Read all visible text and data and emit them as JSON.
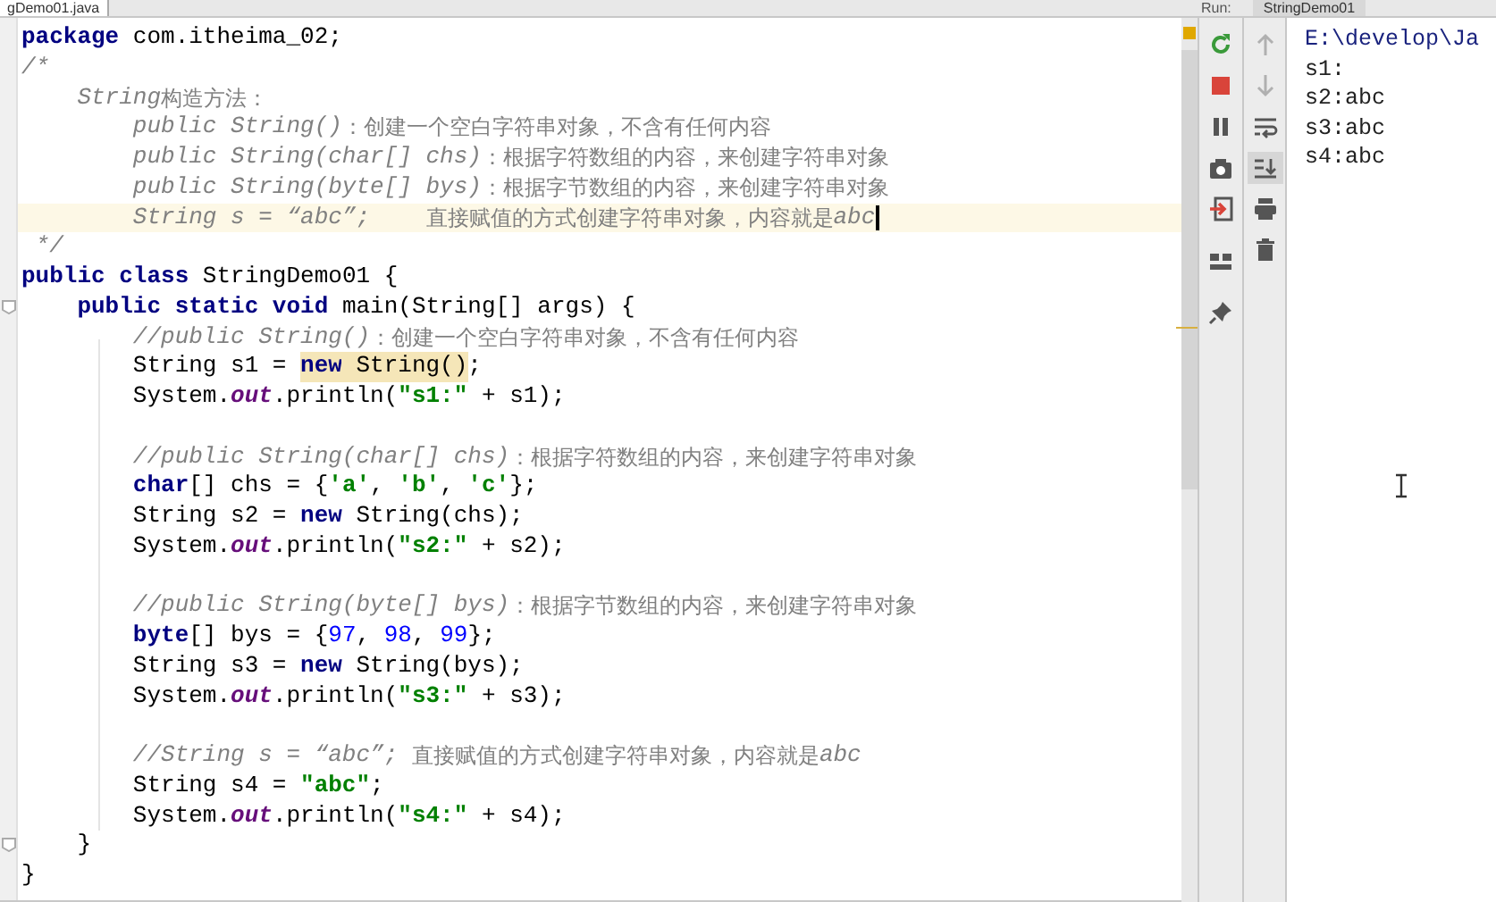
{
  "editor_tab": {
    "label": "gDemo01.java"
  },
  "run_panel": {
    "label": "Run:",
    "tab": "StringDemo01"
  },
  "code_lines": [
    {
      "current": false,
      "tokens": [
        {
          "kind": "keyword",
          "text": "package"
        },
        {
          "kind": "plain",
          "text": " com.itheima_02;"
        }
      ]
    },
    {
      "current": false,
      "tokens": [
        {
          "kind": "doc",
          "text": "/*"
        }
      ]
    },
    {
      "current": false,
      "tokens": [
        {
          "kind": "doc",
          "text": "    String"
        },
        {
          "kind": "cjk",
          "text": "构造方法："
        }
      ]
    },
    {
      "current": false,
      "tokens": [
        {
          "kind": "doc",
          "text": "        public String()"
        },
        {
          "kind": "cjk",
          "text": "：创建一个空白字符串对象，不含有任何内容"
        }
      ]
    },
    {
      "current": false,
      "tokens": [
        {
          "kind": "doc",
          "text": "        public String(char[] chs)"
        },
        {
          "kind": "cjk",
          "text": "：根据字符数组的内容，来创建字符串对象"
        }
      ]
    },
    {
      "current": false,
      "tokens": [
        {
          "kind": "doc",
          "text": "        public String(byte[] bys)"
        },
        {
          "kind": "cjk",
          "text": "：根据字节数组的内容，来创建字符串对象"
        }
      ]
    },
    {
      "current": true,
      "tokens": [
        {
          "kind": "doc",
          "text": "        String s = “abc”;    "
        },
        {
          "kind": "cjk",
          "text": "直接赋值的方式创建字符串对象，内容就是"
        },
        {
          "kind": "doc",
          "text": "abc"
        }
      ]
    },
    {
      "current": false,
      "tokens": [
        {
          "kind": "doc",
          "text": " */"
        }
      ]
    },
    {
      "current": false,
      "tokens": [
        {
          "kind": "keyword",
          "text": "public class"
        },
        {
          "kind": "plain",
          "text": " StringDemo01 {"
        }
      ]
    },
    {
      "current": false,
      "fold": true,
      "tokens": [
        {
          "kind": "keyword",
          "text": "    public static void"
        },
        {
          "kind": "plain",
          "text": " main(String[] args) {"
        }
      ]
    },
    {
      "current": false,
      "tokens": [
        {
          "kind": "doc",
          "text": "        //public String()"
        },
        {
          "kind": "cjk",
          "text": "：创建一个空白字符串对象，不含有任何内容"
        }
      ]
    },
    {
      "current": false,
      "tokens": [
        {
          "kind": "plain",
          "text": "        String s1 = "
        },
        {
          "kind": "match_keyword",
          "text": "new"
        },
        {
          "kind": "match_plain",
          "text": " String()"
        },
        {
          "kind": "plain",
          "text": ";"
        }
      ]
    },
    {
      "current": false,
      "tokens": [
        {
          "kind": "plain",
          "text": "        System."
        },
        {
          "kind": "field",
          "text": "out"
        },
        {
          "kind": "plain",
          "text": ".println("
        },
        {
          "kind": "string",
          "text": "\"s1:\""
        },
        {
          "kind": "plain",
          "text": " + s1);"
        }
      ]
    },
    {
      "current": false
    },
    {
      "current": false,
      "tokens": [
        {
          "kind": "doc",
          "text": "        //public String(char[] chs)"
        },
        {
          "kind": "cjk",
          "text": "：根据字符数组的内容，来创建字符串对象"
        }
      ]
    },
    {
      "current": false,
      "tokens": [
        {
          "kind": "keyword",
          "text": "        char"
        },
        {
          "kind": "plain",
          "text": "[] chs = {"
        },
        {
          "kind": "string",
          "text": "'a'"
        },
        {
          "kind": "plain",
          "text": ", "
        },
        {
          "kind": "string",
          "text": "'b'"
        },
        {
          "kind": "plain",
          "text": ", "
        },
        {
          "kind": "string",
          "text": "'c'"
        },
        {
          "kind": "plain",
          "text": "};"
        }
      ]
    },
    {
      "current": false,
      "tokens": [
        {
          "kind": "plain",
          "text": "        String s2 = "
        },
        {
          "kind": "keyword",
          "text": "new"
        },
        {
          "kind": "plain",
          "text": " String(chs);"
        }
      ]
    },
    {
      "current": false,
      "tokens": [
        {
          "kind": "plain",
          "text": "        System."
        },
        {
          "kind": "field",
          "text": "out"
        },
        {
          "kind": "plain",
          "text": ".println("
        },
        {
          "kind": "string",
          "text": "\"s2:\""
        },
        {
          "kind": "plain",
          "text": " + s2);"
        }
      ]
    },
    {
      "current": false
    },
    {
      "current": false,
      "tokens": [
        {
          "kind": "doc",
          "text": "        //public String(byte[] bys)"
        },
        {
          "kind": "cjk",
          "text": "：根据字节数组的内容，来创建字符串对象"
        }
      ]
    },
    {
      "current": false,
      "tokens": [
        {
          "kind": "keyword",
          "text": "        byte"
        },
        {
          "kind": "plain",
          "text": "[] bys = {"
        },
        {
          "kind": "number",
          "text": "97"
        },
        {
          "kind": "plain",
          "text": ", "
        },
        {
          "kind": "number",
          "text": "98"
        },
        {
          "kind": "plain",
          "text": ", "
        },
        {
          "kind": "number",
          "text": "99"
        },
        {
          "kind": "plain",
          "text": "};"
        }
      ]
    },
    {
      "current": false,
      "tokens": [
        {
          "kind": "plain",
          "text": "        String s3 = "
        },
        {
          "kind": "keyword",
          "text": "new"
        },
        {
          "kind": "plain",
          "text": " String(bys);"
        }
      ]
    },
    {
      "current": false,
      "tokens": [
        {
          "kind": "plain",
          "text": "        System."
        },
        {
          "kind": "field",
          "text": "out"
        },
        {
          "kind": "plain",
          "text": ".println("
        },
        {
          "kind": "string",
          "text": "\"s3:\""
        },
        {
          "kind": "plain",
          "text": " + s3);"
        }
      ]
    },
    {
      "current": false
    },
    {
      "current": false,
      "tokens": [
        {
          "kind": "doc",
          "text": "        //String s = “abc”; "
        },
        {
          "kind": "cjk",
          "text": "直接赋值的方式创建字符串对象，内容就是"
        },
        {
          "kind": "doc",
          "text": "abc"
        }
      ]
    },
    {
      "current": false,
      "tokens": [
        {
          "kind": "plain",
          "text": "        String s4 = "
        },
        {
          "kind": "string",
          "text": "\"abc\""
        },
        {
          "kind": "plain",
          "text": ";"
        }
      ]
    },
    {
      "current": false,
      "tokens": [
        {
          "kind": "plain",
          "text": "        System."
        },
        {
          "kind": "field",
          "text": "out"
        },
        {
          "kind": "plain",
          "text": ".println("
        },
        {
          "kind": "string",
          "text": "\"s4:\""
        },
        {
          "kind": "plain",
          "text": " + s4);"
        }
      ]
    },
    {
      "current": false,
      "fold": true,
      "tokens": [
        {
          "kind": "plain",
          "text": "    }"
        }
      ]
    },
    {
      "current": false,
      "tokens": [
        {
          "kind": "plain",
          "text": "}"
        }
      ]
    }
  ],
  "run_toolbar": [
    {
      "kind": "rerun"
    },
    {
      "kind": "stop"
    },
    {
      "kind": "pause"
    },
    {
      "kind": "camera"
    },
    {
      "kind": "exit"
    },
    {
      "kind": "layout"
    },
    {
      "kind": "pin"
    }
  ],
  "console_toolbar": [
    {
      "kind": "up",
      "disabled": true,
      "selected": false
    },
    {
      "kind": "down",
      "disabled": true,
      "selected": false
    },
    {
      "kind": "wrap",
      "disabled": false,
      "selected": false
    },
    {
      "kind": "scroll_end",
      "disabled": false,
      "selected": true
    },
    {
      "kind": "print",
      "disabled": false,
      "selected": false
    },
    {
      "kind": "trash",
      "disabled": false,
      "selected": false
    }
  ],
  "console_lines": [
    {
      "kind": "command",
      "text": "E:\\develop\\Ja"
    },
    {
      "kind": "output",
      "text": "s1:"
    },
    {
      "kind": "output",
      "text": "s2:abc"
    },
    {
      "kind": "output",
      "text": "s3:abc"
    },
    {
      "kind": "output",
      "text": "s4:abc"
    }
  ]
}
